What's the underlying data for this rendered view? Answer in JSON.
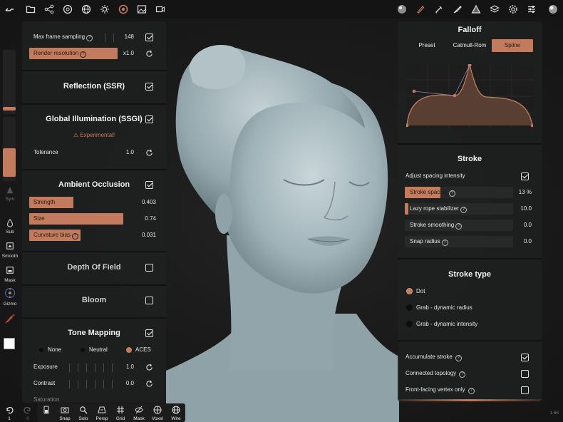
{
  "colors": {
    "accent": "#c27b5c",
    "panel": "#1e1f1f",
    "bg": "#171717"
  },
  "topbar": {
    "left_icons": [
      "wrench-icon",
      "folder-icon",
      "scene-graph-icon",
      "camera-aperture-icon",
      "globe-icon",
      "sun-icon",
      "material-sphere-icon",
      "image-icon",
      "video-icon"
    ],
    "right_icons": [
      "material-preview-icon",
      "brush-icon",
      "pipette-icon",
      "pen-icon",
      "layers-triangle-icon",
      "stack-icon",
      "settings-icon",
      "sliders-icon",
      "matcap-sphere-icon"
    ]
  },
  "left_rail": {
    "sym_label": "Sym",
    "sub_label": "Sub",
    "smooth_label": "Smooth",
    "mask_label": "Mask",
    "gizmo_label": "Gizmo"
  },
  "left_panel": {
    "max_frame": {
      "label": "Max frame sampling",
      "value": "148",
      "checked": true
    },
    "render_res": {
      "label": "Render resolution",
      "value": "x1.0"
    },
    "reflection": {
      "title": "Reflection (SSR)",
      "checked": true
    },
    "gi": {
      "title": "Global Illumination (SSGI)",
      "checked": true,
      "warning": "Experimental!",
      "tolerance_label": "Tolerance",
      "tolerance_value": "1.0"
    },
    "ao": {
      "title": "Ambient Occlusion",
      "checked": true,
      "strength_label": "Strength",
      "strength_value": "0.403",
      "size_label": "Size",
      "size_value": "0.74",
      "curv_label": "Curvature bias",
      "curv_value": "0.031"
    },
    "dof": {
      "title": "Depth Of Field",
      "checked": false
    },
    "bloom": {
      "title": "Bloom",
      "checked": false
    },
    "tone": {
      "title": "Tone Mapping",
      "checked": true,
      "options": [
        "None",
        "Neutral",
        "ACES"
      ],
      "selected": "ACES",
      "exposure_label": "Exposure",
      "exposure_value": "1.0",
      "contrast_label": "Contrast",
      "contrast_value": "0.0",
      "saturation_label": "Saturation"
    }
  },
  "right_panel": {
    "falloff": {
      "title": "Falloff",
      "tabs": [
        "Preset",
        "Catmull-Rom",
        "Spline"
      ],
      "active_tab": "Spline"
    },
    "stroke": {
      "title": "Stroke",
      "adjust_label": "Adjust spacing intensity",
      "adjust_checked": true,
      "spacing_label": "Stroke spacing",
      "spacing_value": "13 %",
      "lazy_label": "Lazy rope stabilizer",
      "lazy_value": "10.0",
      "smoothing_label": "Stroke smoothing",
      "smoothing_value": "0.0",
      "snap_label": "Snap radius",
      "snap_value": "0.0"
    },
    "stroke_type": {
      "title": "Stroke type",
      "options": [
        "Dot",
        "Grab - dynamic radius",
        "Grab - dynamic intensity"
      ],
      "selected": "Dot"
    },
    "options": {
      "accumulate_label": "Accumulate stroke",
      "accumulate_checked": true,
      "connected_label": "Connected topology",
      "connected_checked": false,
      "frontfacing_label": "Front-facing vertex only",
      "frontfacing_checked": false
    }
  },
  "bottombar": {
    "undo_count": "1",
    "redo_count": "0",
    "items": [
      "Snap",
      "Solo",
      "Persp",
      "Grid",
      "Mask",
      "Voxel",
      "Wire"
    ]
  },
  "version": "1.66"
}
